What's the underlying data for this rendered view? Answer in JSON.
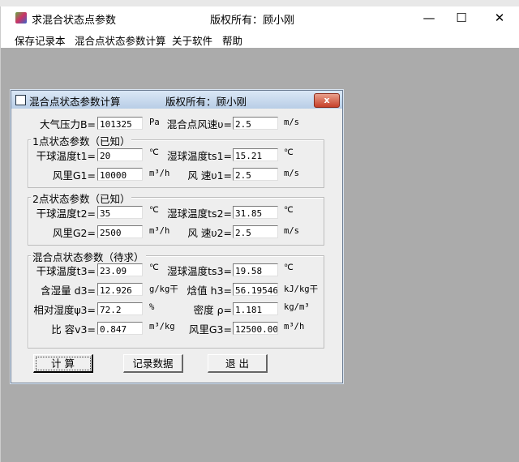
{
  "app": {
    "title": "求混合状态点参数",
    "copyright": "版权所有：顾小刚",
    "window_controls": {
      "minimize": "—",
      "maximize": "☐",
      "close": "✕"
    }
  },
  "menu": [
    "保存记录本",
    "混合点状态参数计算",
    "关于软件",
    "帮助"
  ],
  "child": {
    "title": "混合点状态参数计算",
    "copyright": "版权所有：顾小刚",
    "close": "x"
  },
  "top": {
    "pressure_label": "大气压力B=",
    "pressure": "101325",
    "pressure_unit": "Pa",
    "speed_label": "混合点风速υ=",
    "speed": "2.5",
    "speed_unit": "m/s"
  },
  "group1": {
    "title": "1点状态参数（已知）",
    "t_label": "干球温度t1=",
    "t": "20",
    "t_unit": "℃",
    "ts_label": "湿球温度ts1=",
    "ts": "15.21",
    "ts_unit": "℃",
    "g_label": "风里G1=",
    "g": "10000",
    "g_unit": "m³/h",
    "v_label": "风 速υ1=",
    "v": "2.5",
    "v_unit": "m/s"
  },
  "group2": {
    "title": "2点状态参数（已知）",
    "t_label": "干球温度t2=",
    "t": "35",
    "t_unit": "℃",
    "ts_label": "湿球温度ts2=",
    "ts": "31.85",
    "ts_unit": "℃",
    "g_label": "风里G2=",
    "g": "2500",
    "g_unit": "m³/h",
    "v_label": "风 速υ2=",
    "v": "2.5",
    "v_unit": "m/s"
  },
  "group3": {
    "title": "混合点状态参数（待求）",
    "t_label": "干球温度t3=",
    "t": "23.09",
    "t_unit": "℃",
    "ts_label": "湿球温度ts3=",
    "ts": "19.58",
    "ts_unit": "℃",
    "d_label": "含湿量 d3=",
    "d": "12.926",
    "d_unit": "g/kg干",
    "h_label": "焓值 h3=",
    "h": "56.19546",
    "h_unit": "kJ/kg干",
    "phi_label": "相对湿度ψ3=",
    "phi": "72.2",
    "phi_unit": "%",
    "rho_label": "密度 ρ=",
    "rho": "1.181",
    "rho_unit": "kg/m³",
    "v_label": "比 容v3=",
    "v": "0.847",
    "v_unit": "m³/kg",
    "g_label": "风里G3=",
    "g": "12500.000",
    "g_unit": "m³/h"
  },
  "buttons": {
    "calc": "计 算",
    "record": "记录数据",
    "exit": "退 出"
  }
}
